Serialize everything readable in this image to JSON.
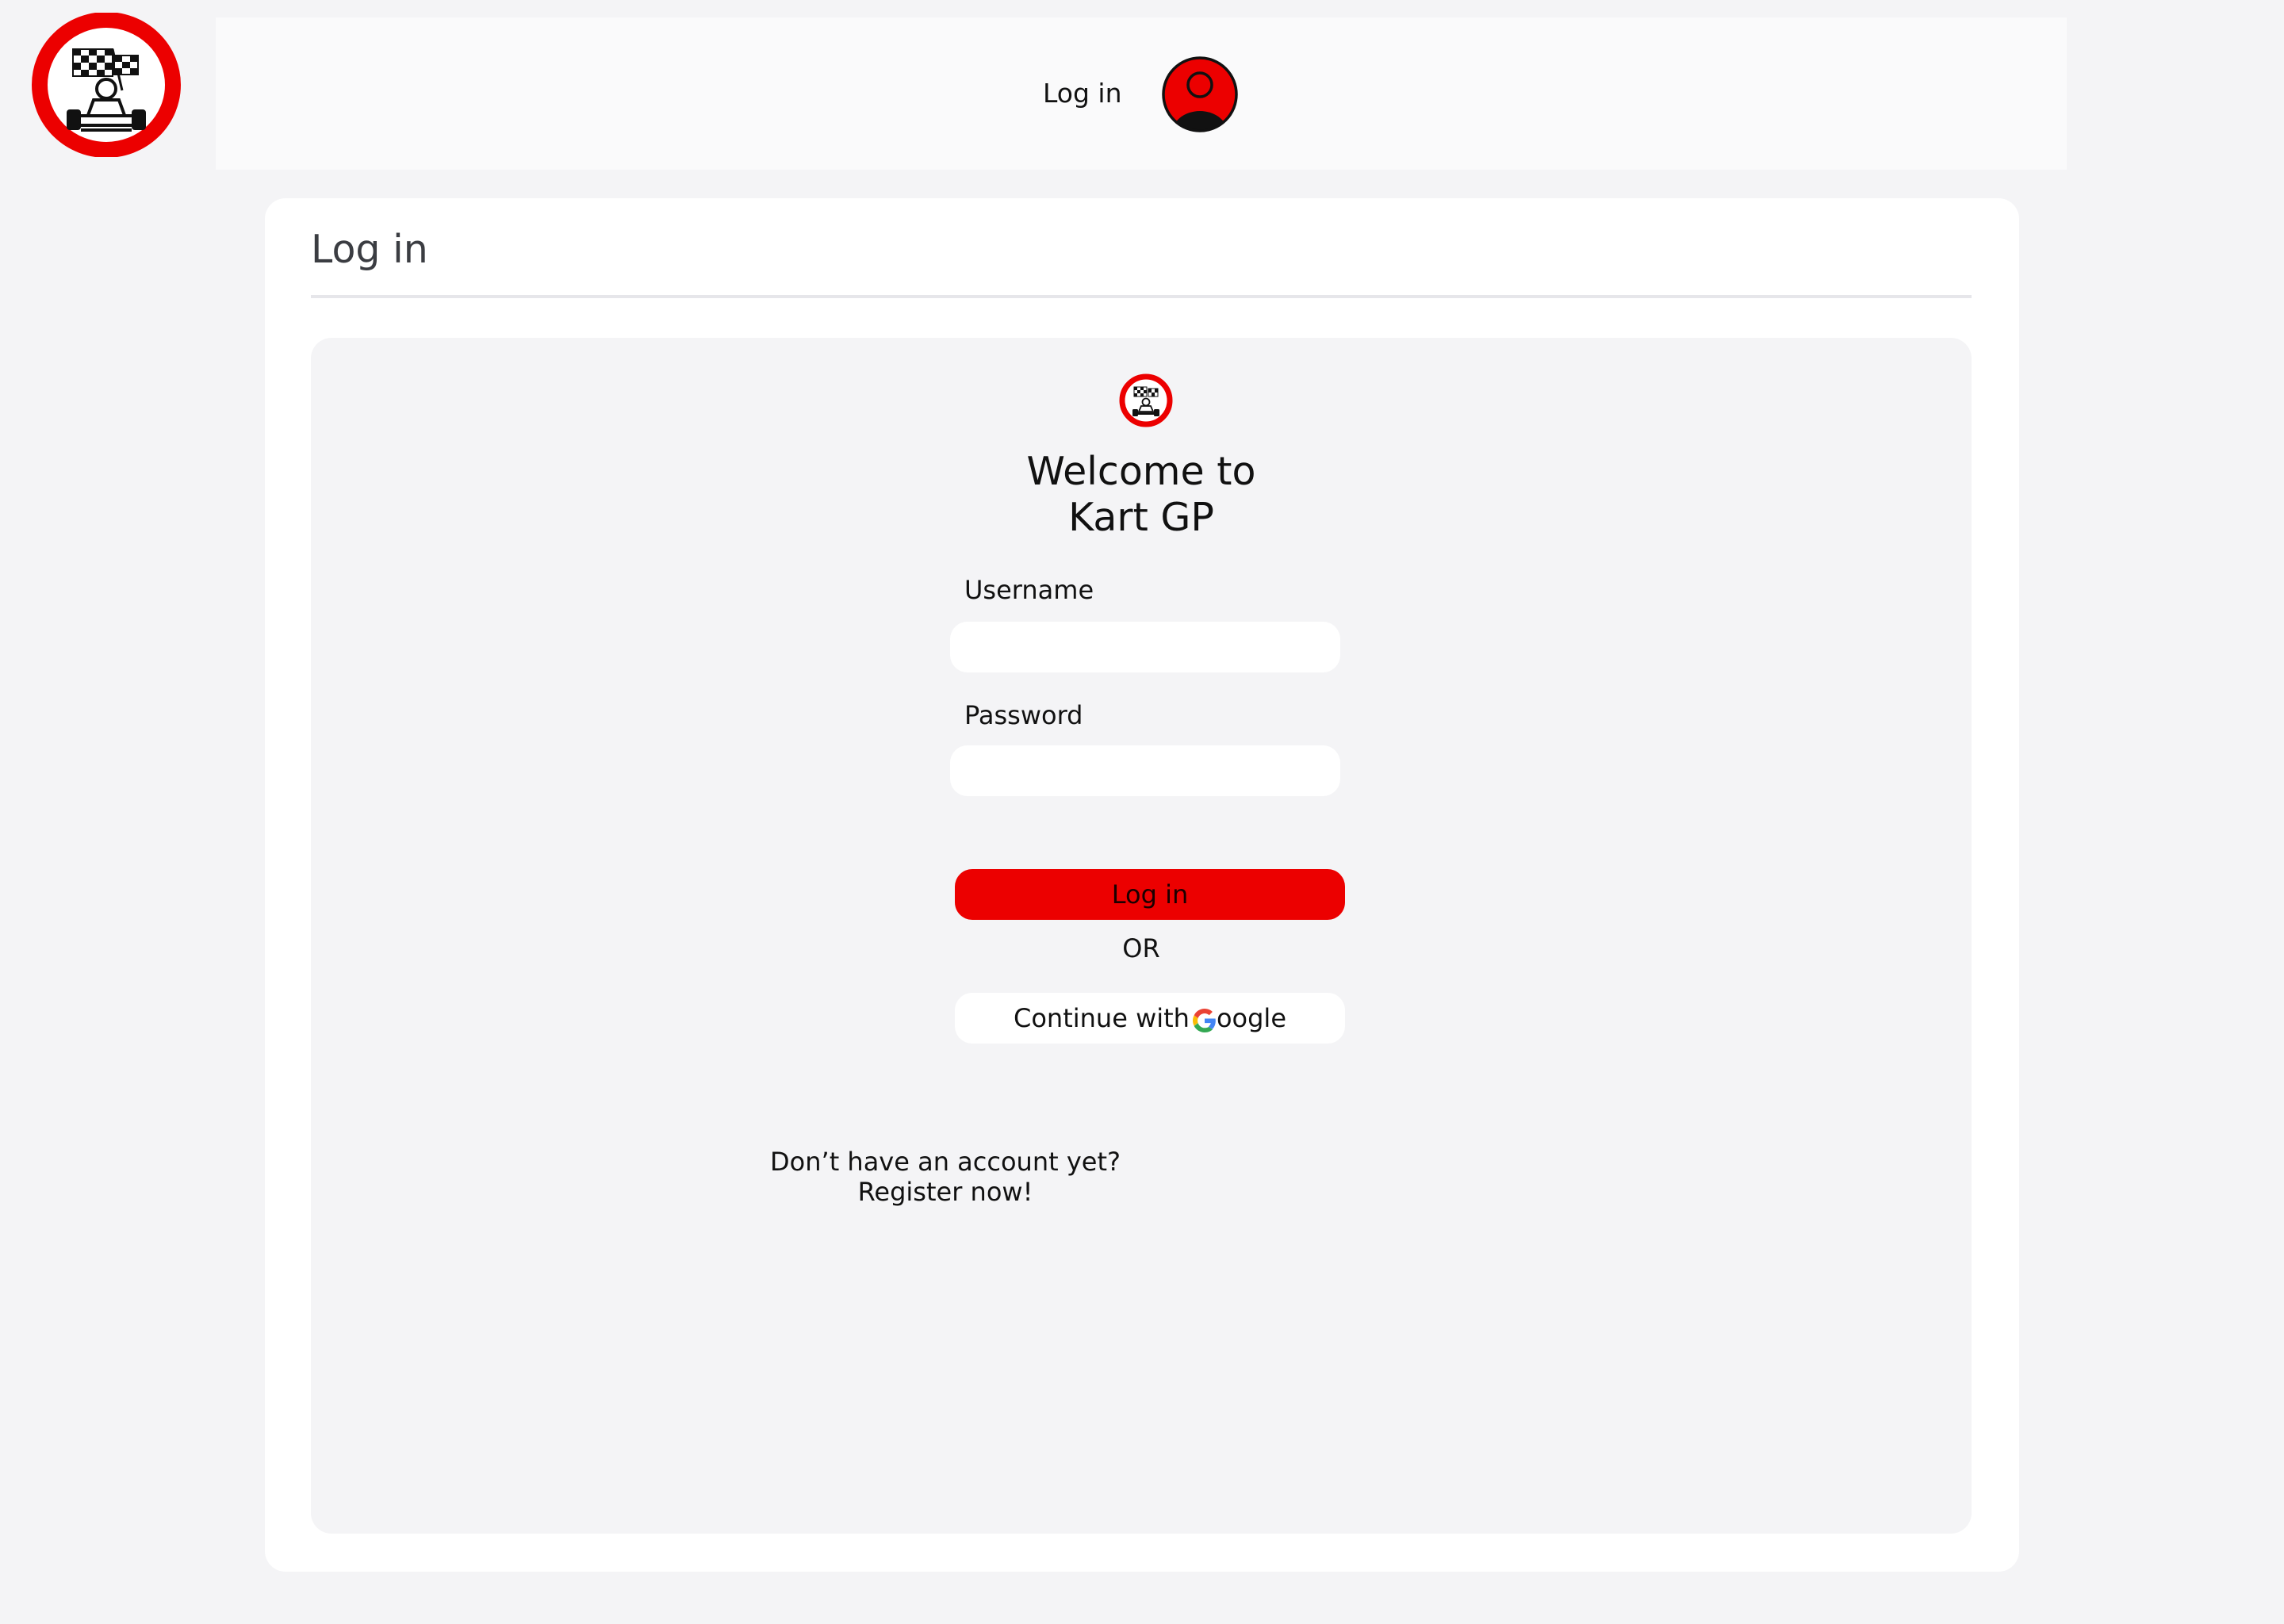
{
  "header": {
    "logo": "kart-gp-logo",
    "login_link": "Log in",
    "avatar_icon": "user-avatar-icon"
  },
  "page": {
    "title": "Log in"
  },
  "login_form": {
    "welcome_line1": "Welcome to",
    "welcome_line2": "Kart GP",
    "username_label": "Username",
    "username_value": "",
    "password_label": "Password",
    "password_value": "",
    "login_button": "Log in",
    "or_text": "OR",
    "google_button_prefix": "Continue with",
    "google_button_suffix": "oogle",
    "google_icon": "google-icon"
  },
  "register": {
    "prompt": "Don’t have an account yet?",
    "link": "Register now!"
  },
  "colors": {
    "brand_red": "#ec0000",
    "page_background": "#f4f4f6",
    "card_background": "#ffffff"
  }
}
